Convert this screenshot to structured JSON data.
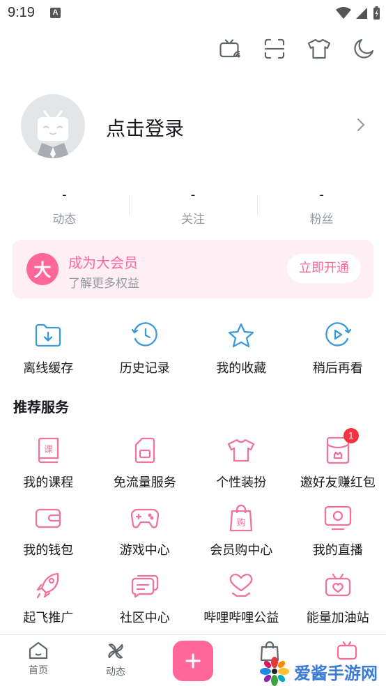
{
  "status_bar": {
    "time": "9:19",
    "notification_letter": "A"
  },
  "top_actions": [
    {
      "icon": "tv-cast-icon"
    },
    {
      "icon": "scan-icon"
    },
    {
      "icon": "tshirt-icon"
    },
    {
      "icon": "moon-icon"
    }
  ],
  "profile": {
    "login_text": "点击登录"
  },
  "stats": [
    {
      "value": "-",
      "label": "动态"
    },
    {
      "value": "-",
      "label": "关注"
    },
    {
      "value": "-",
      "label": "粉丝"
    }
  ],
  "vip": {
    "logo_char": "大",
    "title": "成为大会员",
    "subtitle": "了解更多权益",
    "button": "立即开通"
  },
  "quick_actions": [
    {
      "label": "离线缓存"
    },
    {
      "label": "历史记录"
    },
    {
      "label": "我的收藏"
    },
    {
      "label": "稍后再看"
    }
  ],
  "section_title": "推荐服务",
  "services": [
    {
      "label": "我的课程",
      "icon_text": "课"
    },
    {
      "label": "免流量服务"
    },
    {
      "label": "个性装扮"
    },
    {
      "label": "邀好友赚红包",
      "badge": "1"
    },
    {
      "label": "我的钱包"
    },
    {
      "label": "游戏中心"
    },
    {
      "label": "会员购中心",
      "icon_text": "购"
    },
    {
      "label": "我的直播"
    },
    {
      "label": "起飞推广"
    },
    {
      "label": "社区中心"
    },
    {
      "label": "哔哩哔哩公益"
    },
    {
      "label": "能量加油站"
    }
  ],
  "tabbar": {
    "home": "首页",
    "dynamic": "动态",
    "publish_symbol": "+"
  },
  "watermark": {
    "text": "爱酱手游网"
  },
  "colors": {
    "accent": "#ff6699",
    "blue_icon": "#3d9ad6",
    "vip_bg": "#ffeef3",
    "badge": "#f5343f"
  }
}
